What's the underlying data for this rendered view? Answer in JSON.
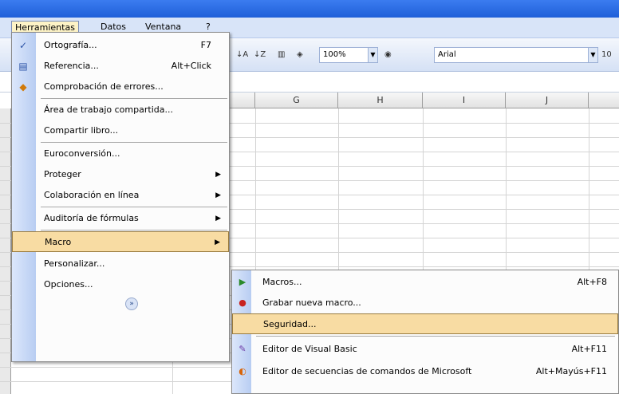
{
  "menubar": {
    "items": [
      {
        "label": "Herramientas",
        "active": true
      },
      {
        "label": "Datos"
      },
      {
        "label": "Ventana"
      },
      {
        "label": "?"
      }
    ]
  },
  "toolbar": {
    "zoom": "100%",
    "font": "Arial",
    "font_size": "10"
  },
  "grid": {
    "columns": [
      "G",
      "H",
      "I",
      "J"
    ]
  },
  "tools_menu": {
    "items": [
      {
        "label": "Ortografía...",
        "shortcut": "F7",
        "icon": "spellcheck-icon"
      },
      {
        "label": "Referencia...",
        "shortcut": "Alt+Click",
        "icon": "research-icon"
      },
      {
        "label": "Comprobación de errores...",
        "icon": "error-check-icon"
      },
      {
        "label": "Área de trabajo compartida..."
      },
      {
        "label": "Compartir libro..."
      },
      {
        "label": "Euroconversión..."
      },
      {
        "label": "Proteger",
        "submenu": true
      },
      {
        "label": "Colaboración en línea",
        "submenu": true
      },
      {
        "label": "Auditoría de fórmulas",
        "submenu": true
      },
      {
        "label": "Macro",
        "submenu": true,
        "highlighted": true
      },
      {
        "label": "Personalizar..."
      },
      {
        "label": "Opciones..."
      }
    ]
  },
  "macro_submenu": {
    "items": [
      {
        "label": "Macros...",
        "shortcut": "Alt+F8",
        "icon": "play-icon"
      },
      {
        "label": "Grabar nueva macro...",
        "icon": "record-icon"
      },
      {
        "label": "Seguridad...",
        "highlighted": true
      },
      {
        "label": "Editor de Visual Basic",
        "shortcut": "Alt+F11",
        "icon": "vb-editor-icon"
      },
      {
        "label": "Editor de secuencias de comandos de Microsoft",
        "shortcut": "Alt+Mayús+F11",
        "icon": "script-editor-icon"
      }
    ]
  },
  "colors": {
    "highlight": "#f8dca3",
    "gutter": "#c6d7f5",
    "titlebar": "#2a6ae0"
  }
}
